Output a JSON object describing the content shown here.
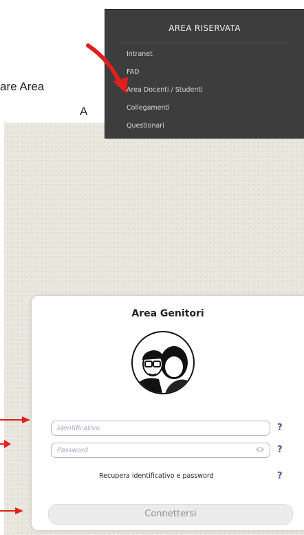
{
  "page": {
    "text_line1": "are Area",
    "text_line2": "A"
  },
  "menu": {
    "title": "AREA RISERVATA",
    "items": [
      {
        "label": "Intranet"
      },
      {
        "label": "FAD"
      },
      {
        "label": "Area Docenti / Studenti"
      },
      {
        "label": "Collegamenti"
      },
      {
        "label": "Questionari"
      }
    ]
  },
  "login": {
    "title": "Area Genitori",
    "identifier_placeholder": "Identificativo",
    "password_placeholder": "Password",
    "help_symbol": "?",
    "recover_label": "Recupera identificativo e password",
    "connect_label": "Connettersi"
  },
  "colors": {
    "annotation_red": "#e0201c",
    "menu_bg": "#3d3d3d",
    "accent": "#5b4e9c"
  },
  "icons": [
    "red-arrow-icon",
    "avatar-icon",
    "eye-icon",
    "help-icon"
  ]
}
